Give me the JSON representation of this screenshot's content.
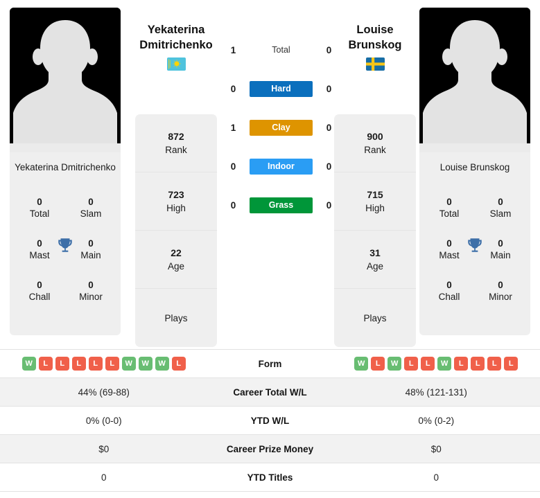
{
  "players": {
    "left": {
      "first_name": "Yekaterina",
      "last_name": "Dmitrichenko",
      "full_name": "Yekaterina Dmitrichenko",
      "flag_country": "Kazakhstan",
      "stats": [
        {
          "value": "872",
          "label": "Rank"
        },
        {
          "value": "723",
          "label": "High"
        },
        {
          "value": "22",
          "label": "Age"
        },
        {
          "value": "",
          "label": "Plays"
        }
      ],
      "titles": [
        {
          "value": "0",
          "label": "Total"
        },
        {
          "value": "0",
          "label": "Slam"
        },
        {
          "value": "0",
          "label": "Mast"
        },
        {
          "value": "0",
          "label": "Main"
        },
        {
          "value": "0",
          "label": "Chall"
        },
        {
          "value": "0",
          "label": "Minor"
        }
      ],
      "form": [
        "W",
        "L",
        "L",
        "L",
        "L",
        "L",
        "W",
        "W",
        "W",
        "L"
      ],
      "career_total_wl": "44% (69-88)",
      "ytd_wl": "0% (0-0)",
      "career_prize_money": "$0",
      "ytd_titles": "0"
    },
    "right": {
      "first_name": "Louise",
      "last_name": "Brunskog",
      "full_name": "Louise Brunskog",
      "flag_country": "Sweden",
      "stats": [
        {
          "value": "900",
          "label": "Rank"
        },
        {
          "value": "715",
          "label": "High"
        },
        {
          "value": "31",
          "label": "Age"
        },
        {
          "value": "",
          "label": "Plays"
        }
      ],
      "titles": [
        {
          "value": "0",
          "label": "Total"
        },
        {
          "value": "0",
          "label": "Slam"
        },
        {
          "value": "0",
          "label": "Mast"
        },
        {
          "value": "0",
          "label": "Main"
        },
        {
          "value": "0",
          "label": "Chall"
        },
        {
          "value": "0",
          "label": "Minor"
        }
      ],
      "form": [
        "W",
        "L",
        "W",
        "L",
        "L",
        "W",
        "L",
        "L",
        "L",
        "L"
      ],
      "career_total_wl": "48% (121-131)",
      "ytd_wl": "0% (0-2)",
      "career_prize_money": "$0",
      "ytd_titles": "0"
    }
  },
  "h2h": [
    {
      "label": "Total",
      "left": "1",
      "right": "0",
      "color": "none",
      "style": "plain"
    },
    {
      "label": "Hard",
      "left": "0",
      "right": "0",
      "color": "#0b6fbd",
      "style": "badge"
    },
    {
      "label": "Clay",
      "left": "1",
      "right": "0",
      "color": "#de9400",
      "style": "badge"
    },
    {
      "label": "Indoor",
      "left": "0",
      "right": "0",
      "color": "#2a9df4",
      "style": "badge"
    },
    {
      "label": "Grass",
      "left": "0",
      "right": "0",
      "color": "#009639",
      "style": "badge"
    }
  ],
  "comparison_rows": [
    {
      "key": "form",
      "label": "Form",
      "type": "form"
    },
    {
      "key": "career_total_wl",
      "label": "Career Total W/L",
      "type": "text"
    },
    {
      "key": "ytd_wl",
      "label": "YTD W/L",
      "type": "text"
    },
    {
      "key": "career_prize_money",
      "label": "Career Prize Money",
      "type": "text"
    },
    {
      "key": "ytd_titles",
      "label": "YTD Titles",
      "type": "text"
    }
  ],
  "colors": {
    "hard": "#0b6fbd",
    "clay": "#de9400",
    "indoor": "#2a9df4",
    "grass": "#009639",
    "win_badge": "#68bd72",
    "loss_badge": "#f0604a",
    "trophy": "#3d6fa8",
    "card_bg": "#efefef",
    "row_alt_bg": "#f2f2f2"
  }
}
